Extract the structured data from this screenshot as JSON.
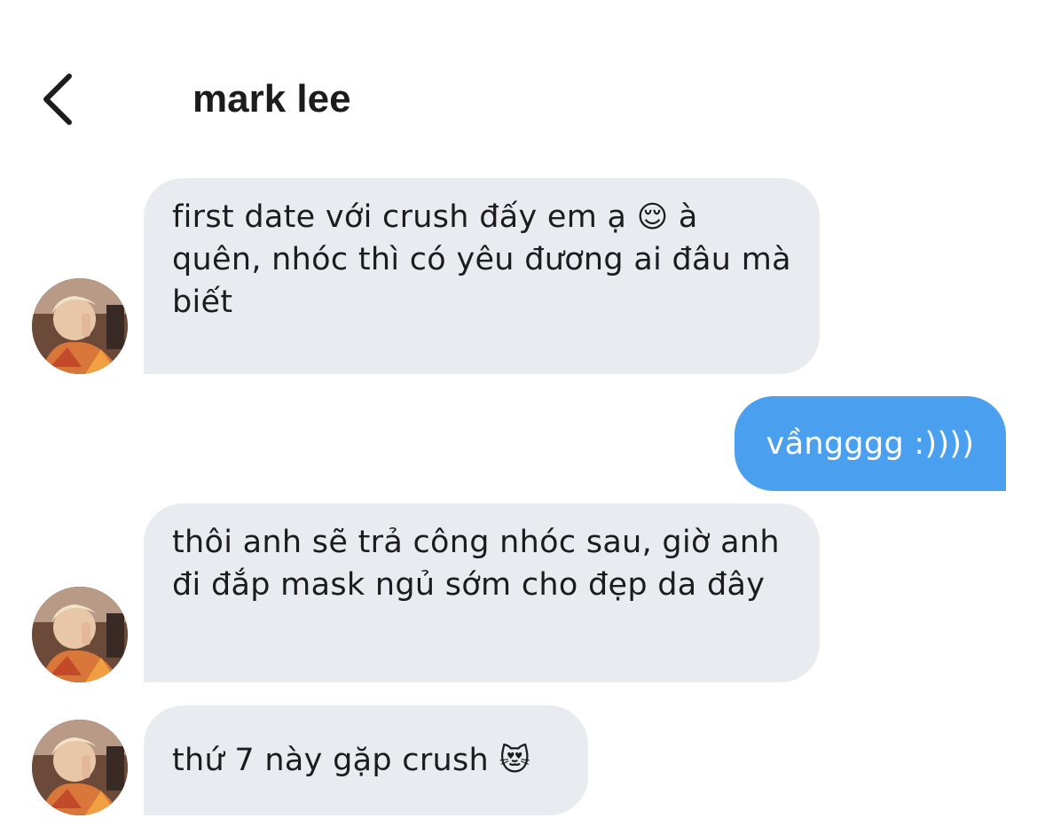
{
  "header": {
    "title": "mark lee",
    "back_icon": "chevron-left-icon"
  },
  "avatar": {
    "icon": "user-avatar-photo"
  },
  "messages": [
    {
      "direction": "incoming",
      "text_before": "first date với crush đấy em ạ ",
      "emoji": "😌",
      "text_after": " à quên, nhóc thì có yêu đương ai đâu mà biết"
    },
    {
      "direction": "outgoing",
      "text": "vầngggg :))))"
    },
    {
      "direction": "incoming",
      "text": "thôi anh sẽ trả công nhóc sau, giờ anh đi đắp mask ngủ sớm cho đẹp da đây"
    },
    {
      "direction": "incoming",
      "text_before": "thứ 7 này gặp crush ",
      "emoji": "😻"
    }
  ],
  "colors": {
    "incoming_bubble": "#e8ecf0",
    "outgoing_bubble": "#4aa0ee",
    "text": "#1c1c1e"
  }
}
